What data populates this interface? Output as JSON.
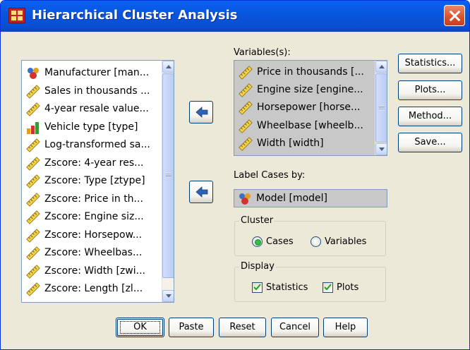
{
  "window": {
    "title": "Hierarchical Cluster Analysis"
  },
  "source_list": {
    "items": [
      {
        "label": "Manufacturer [man...",
        "icon": "nominal-variable-icon"
      },
      {
        "label": "Sales in thousands ...",
        "icon": "scale-variable-icon"
      },
      {
        "label": "4-year resale value...",
        "icon": "scale-variable-icon"
      },
      {
        "label": "Vehicle type [type]",
        "icon": "ordinal-variable-icon"
      },
      {
        "label": "Log-transformed sa...",
        "icon": "scale-variable-icon"
      },
      {
        "label": "Zscore:  4-year res...",
        "icon": "scale-variable-icon"
      },
      {
        "label": "Zscore:  Type [ztype]",
        "icon": "scale-variable-icon"
      },
      {
        "label": "Zscore:  Price in th...",
        "icon": "scale-variable-icon"
      },
      {
        "label": "Zscore:  Engine siz...",
        "icon": "scale-variable-icon"
      },
      {
        "label": "Zscore:  Horsepow...",
        "icon": "scale-variable-icon"
      },
      {
        "label": "Zscore:  Wheelbas...",
        "icon": "scale-variable-icon"
      },
      {
        "label": "Zscore:  Width [zwi...",
        "icon": "scale-variable-icon"
      },
      {
        "label": "Zscore:  Length [zl...",
        "icon": "scale-variable-icon"
      }
    ]
  },
  "variables": {
    "label": "Variables(s):",
    "items": [
      {
        "label": "Price in thousands [...",
        "icon": "scale-variable-icon"
      },
      {
        "label": "Engine size [engine...",
        "icon": "scale-variable-icon"
      },
      {
        "label": "Horsepower [horse...",
        "icon": "scale-variable-icon"
      },
      {
        "label": "Wheelbase [wheelb...",
        "icon": "scale-variable-icon"
      },
      {
        "label": "Width [width]",
        "icon": "scale-variable-icon"
      }
    ]
  },
  "label_cases": {
    "label": "Label Cases by:",
    "value": "Model [model]"
  },
  "cluster": {
    "title": "Cluster",
    "options": [
      "Cases",
      "Variables"
    ],
    "selected": "Cases"
  },
  "display": {
    "title": "Display",
    "statistics": {
      "label": "Statistics",
      "checked": true
    },
    "plots": {
      "label": "Plots",
      "checked": true
    }
  },
  "side_buttons": [
    "Statistics...",
    "Plots...",
    "Method...",
    "Save..."
  ],
  "bottom_buttons": [
    "OK",
    "Paste",
    "Reset",
    "Cancel",
    "Help"
  ]
}
